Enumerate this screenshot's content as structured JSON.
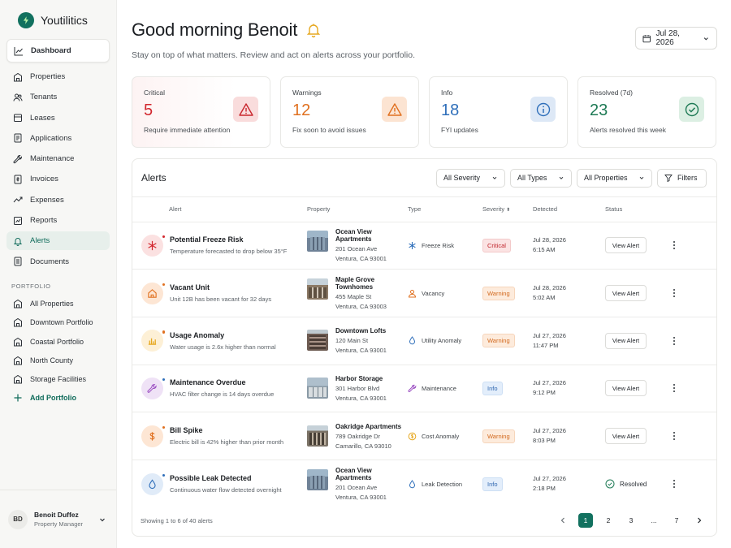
{
  "app": {
    "name": "Youtilitics"
  },
  "nav": {
    "items": [
      {
        "label": "Dashboard",
        "icon": "chart-line-icon"
      },
      {
        "label": "Properties",
        "icon": "building-icon"
      },
      {
        "label": "Tenants",
        "icon": "users-icon"
      },
      {
        "label": "Leases",
        "icon": "folder-icon"
      },
      {
        "label": "Applications",
        "icon": "document-icon"
      },
      {
        "label": "Maintenance",
        "icon": "wrench-icon"
      },
      {
        "label": "Invoices",
        "icon": "invoice-icon"
      },
      {
        "label": "Expenses",
        "icon": "trending-icon"
      },
      {
        "label": "Reports",
        "icon": "report-icon"
      },
      {
        "label": "Alerts",
        "icon": "bell-icon"
      },
      {
        "label": "Documents",
        "icon": "documents-icon"
      }
    ],
    "active": "Alerts"
  },
  "portfolio": {
    "label": "PORTFOLIO",
    "items": [
      "All Properties",
      "Downtown Portfolio",
      "Coastal Portfolio",
      "North County",
      "Storage Facilities"
    ],
    "add_label": "Add Portfolio"
  },
  "user": {
    "initials": "BD",
    "name": "Benoit Duffez",
    "role": "Property Manager"
  },
  "header": {
    "greeting": "Good morning Benoit",
    "subtitle": "Stay on top of what matters. Review and act on alerts across your portfolio.",
    "date": "Jul 28, 2026"
  },
  "stats": [
    {
      "label": "Critical",
      "value": "5",
      "desc": "Require immediate attention",
      "color": "#d2272e"
    },
    {
      "label": "Warnings",
      "value": "12",
      "desc": "Fix soon to avoid issues",
      "color": "#e0701f"
    },
    {
      "label": "Info",
      "value": "18",
      "desc": "FYI updates",
      "color": "#2f6fba"
    },
    {
      "label": "Resolved (7d)",
      "value": "23",
      "desc": "Alerts resolved this week",
      "color": "#1e7a55"
    }
  ],
  "alerts_panel": {
    "title": "Alerts",
    "filters": {
      "severity": "All Severity",
      "types": "All Types",
      "properties": "All Properties",
      "filters_label": "Filters"
    },
    "columns": {
      "alert": "Alert",
      "property": "Property",
      "type": "Type",
      "severity": "Severity",
      "detected": "Detected",
      "status": "Status"
    },
    "rows": [
      {
        "title": "Potential Freeze Risk",
        "sub": "Temperature forecasted to drop below 35°F",
        "icon": "snowflake-icon",
        "prop_name": "Ocean View Apartments",
        "addr1": "201 Ocean Ave",
        "addr2": "Ventura, CA 93001",
        "type": "Freeze Risk",
        "type_icon": "snowflake-icon",
        "severity": "Critical",
        "date": "Jul 28, 2026",
        "time": "6:15 AM",
        "status": "View Alert"
      },
      {
        "title": "Vacant Unit",
        "sub": "Unit 12B has been vacant for 32 days",
        "icon": "home-icon",
        "prop_name": "Maple Grove Townhomes",
        "addr1": "455 Maple St",
        "addr2": "Ventura, CA 93003",
        "type": "Vacancy",
        "type_icon": "user-icon",
        "severity": "Warning",
        "date": "Jul 28, 2026",
        "time": "5:02 AM",
        "status": "View Alert"
      },
      {
        "title": "Usage Anomaly",
        "sub": "Water usage is 2.6x higher than normal",
        "icon": "bar-chart-icon",
        "prop_name": "Downtown Lofts",
        "addr1": "120 Main St",
        "addr2": "Ventura, CA 93001",
        "type": "Utility Anomaly",
        "type_icon": "droplet-icon",
        "severity": "Warning",
        "date": "Jul 27, 2026",
        "time": "11:47 PM",
        "status": "View Alert"
      },
      {
        "title": "Maintenance Overdue",
        "sub": "HVAC filter change is 14 days overdue",
        "icon": "wrench-icon",
        "prop_name": "Harbor Storage",
        "addr1": "301 Harbor Blvd",
        "addr2": "Ventura, CA 93001",
        "type": "Maintenance",
        "type_icon": "wrench-icon",
        "severity": "Info",
        "date": "Jul 27, 2026",
        "time": "9:12 PM",
        "status": "View Alert"
      },
      {
        "title": "Bill Spike",
        "sub": "Electric bill is 42% higher than prior month",
        "icon": "dollar-icon",
        "prop_name": "Oakridge Apartments",
        "addr1": "789 Oakridge Dr",
        "addr2": "Camarillo, CA 93010",
        "type": "Cost Anomaly",
        "type_icon": "coin-icon",
        "severity": "Warning",
        "date": "Jul 27, 2026",
        "time": "8:03 PM",
        "status": "View Alert"
      },
      {
        "title": "Possible Leak Detected",
        "sub": "Continuous water flow detected overnight",
        "icon": "droplet-icon",
        "prop_name": "Ocean View Apartments",
        "addr1": "201 Ocean Ave",
        "addr2": "Ventura, CA 93001",
        "type": "Leak Detection",
        "type_icon": "droplet-icon",
        "severity": "Info",
        "date": "Jul 27, 2026",
        "time": "2:18 PM",
        "status": "Resolved"
      }
    ],
    "showing": "Showing 1 to 6 of 40 alerts",
    "pages": [
      "1",
      "2",
      "3",
      "...",
      "7"
    ],
    "current_page": "1"
  },
  "colors": {
    "brand": "#12715f",
    "critical": "#d2272e",
    "warning": "#e0701f",
    "info": "#2f6fba",
    "success": "#1e7a55"
  }
}
